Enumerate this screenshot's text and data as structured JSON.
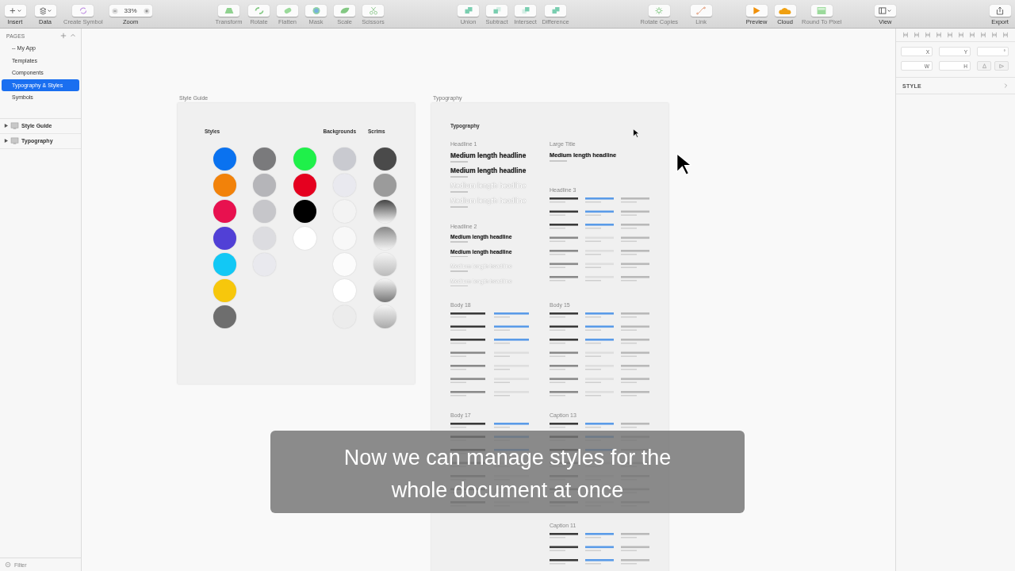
{
  "toolbar": {
    "groups": [
      [
        {
          "label": "Insert",
          "kind": "insert",
          "disabled": false
        },
        {
          "label": "Data",
          "kind": "data",
          "disabled": false
        },
        {
          "label": "Create Symbol",
          "kind": "symbol",
          "disabled": true
        },
        {
          "label": "Zoom",
          "kind": "zoom",
          "value": "33%",
          "disabled": false
        }
      ],
      [
        {
          "label": "Transform",
          "kind": "transform",
          "disabled": true
        },
        {
          "label": "Rotate",
          "kind": "rotate",
          "disabled": true
        },
        {
          "label": "Flatten",
          "kind": "flatten",
          "disabled": true
        },
        {
          "label": "Mask",
          "kind": "mask",
          "disabled": true
        },
        {
          "label": "Scale",
          "kind": "scale",
          "disabled": true
        },
        {
          "label": "Scissors",
          "kind": "scissors",
          "disabled": true
        }
      ],
      [
        {
          "label": "Union",
          "kind": "union",
          "disabled": true
        },
        {
          "label": "Subtract",
          "kind": "subtract",
          "disabled": true
        },
        {
          "label": "Intersect",
          "kind": "intersect",
          "disabled": true
        },
        {
          "label": "Difference",
          "kind": "difference",
          "disabled": true
        }
      ],
      [
        {
          "label": "Rotate Copies",
          "kind": "copies",
          "disabled": true
        },
        {
          "label": "Link",
          "kind": "link",
          "disabled": true
        }
      ],
      [
        {
          "label": "Preview",
          "kind": "preview",
          "disabled": false
        },
        {
          "label": "Cloud",
          "kind": "cloud",
          "disabled": false
        },
        {
          "label": "Round To Pixel",
          "kind": "round",
          "disabled": true
        }
      ],
      [
        {
          "label": "View",
          "kind": "view",
          "disabled": false
        }
      ],
      [
        {
          "label": "Export",
          "kind": "export",
          "disabled": false
        }
      ]
    ]
  },
  "sidebar": {
    "pages_title": "PAGES",
    "pages": [
      {
        "label": "-- My App",
        "selected": false
      },
      {
        "label": "Templates",
        "selected": false
      },
      {
        "label": "Components",
        "selected": false
      },
      {
        "label": "Typography & Styles",
        "selected": true
      },
      {
        "label": "Symbols",
        "selected": false
      }
    ],
    "artboards": [
      {
        "label": "Style Guide",
        "expanded": false
      },
      {
        "label": "Typography",
        "expanded": false
      }
    ],
    "filter": {
      "placeholder": "Filter"
    }
  },
  "inspector": {
    "fields": [
      {
        "label": "X"
      },
      {
        "label": "Y"
      },
      {
        "label": "°"
      },
      {
        "label": "W"
      },
      {
        "label": "H"
      }
    ],
    "style_label": "STYLE"
  },
  "style_guide": {
    "title": "Style Guide",
    "columns": [
      {
        "heading": "Styles",
        "swatches": [
          {
            "kind": "solid",
            "color": "#0a72f0"
          },
          {
            "kind": "solid",
            "color": "#f2820a"
          },
          {
            "kind": "solid",
            "color": "#e8114f"
          },
          {
            "kind": "solid",
            "color": "#5140d6"
          },
          {
            "kind": "solid",
            "color": "#12c8f5"
          },
          {
            "kind": "solid",
            "color": "#f7c70c"
          },
          {
            "kind": "solid",
            "color": "#6e6e6e"
          }
        ]
      },
      {
        "swatches": [
          {
            "kind": "solid",
            "color": "#7a7a7c"
          },
          {
            "kind": "solid",
            "color": "#b5b5b9"
          },
          {
            "kind": "solid",
            "color": "#c6c6ca"
          },
          {
            "kind": "solid",
            "color": "#dcdce0"
          },
          {
            "kind": "solid",
            "color": "#e9e9ee"
          }
        ]
      },
      {
        "swatches": [
          {
            "kind": "solid",
            "color": "#1ff04a"
          },
          {
            "kind": "solid",
            "color": "#e5001f"
          },
          {
            "kind": "solid",
            "color": "#000000"
          },
          {
            "kind": "solid",
            "color": "#ffffff"
          }
        ]
      },
      {
        "heading": "Backgrounds",
        "swatches": [
          {
            "kind": "solid",
            "color": "#c9cad0"
          },
          {
            "kind": "solid",
            "color": "#e9e9ef"
          },
          {
            "kind": "solid",
            "color": "#f3f3f3"
          },
          {
            "kind": "solid",
            "color": "#f8f8f8"
          },
          {
            "kind": "solid",
            "color": "#fcfcfc"
          },
          {
            "kind": "solid",
            "color": "#ffffff"
          },
          {
            "kind": "solid",
            "color": "#ececec"
          }
        ]
      },
      {
        "heading": "Scrims",
        "swatches": [
          {
            "kind": "solid",
            "color": "#4a4a4a"
          },
          {
            "kind": "solid",
            "color": "#9b9b9b"
          },
          {
            "kind": "gradient"
          },
          {
            "kind": "gradient"
          },
          {
            "kind": "gradient-up"
          },
          {
            "kind": "gradient-up"
          },
          {
            "kind": "gradient-up"
          }
        ]
      }
    ]
  },
  "typography": {
    "title": "Typography",
    "heading": "Typography",
    "columns": [
      {
        "sections": [
          {
            "label": "Headline 1",
            "kind": "large",
            "items": [
              {
                "text": "Medium length headline",
                "color": "#222222"
              },
              {
                "text": "Medium length headline",
                "color": "#222222"
              },
              {
                "text": "Medium length headline",
                "color": "#ffffff"
              },
              {
                "text": "Medium length headline",
                "color": "#ffffff"
              }
            ]
          },
          {
            "label": "Headline 2",
            "kind": "medium",
            "items": [
              {
                "text": "Medium length headline",
                "color": "#222222"
              },
              {
                "text": "Medium length headline",
                "color": "#222222"
              },
              {
                "text": "Medium length headline",
                "color": "#ffffff"
              },
              {
                "text": "Medium length headline",
                "color": "#ffffff"
              }
            ]
          },
          {
            "label": "Body 18",
            "kind": "lines"
          },
          {
            "label": "Body 17",
            "kind": "lines"
          }
        ]
      },
      {
        "sections": [
          {
            "label": "Large Title",
            "kind": "title",
            "items": [
              {
                "text": "Medium length headline",
                "color": "#222222"
              }
            ]
          },
          {
            "label": "Headline 3",
            "kind": "lines"
          },
          {
            "label": "Body 15",
            "kind": "lines"
          },
          {
            "label": "Caption 13",
            "kind": "lines"
          },
          {
            "label": "Caption 11",
            "kind": "lines"
          }
        ]
      }
    ]
  },
  "subtitle": "Now we can manage styles for the whole document at once"
}
